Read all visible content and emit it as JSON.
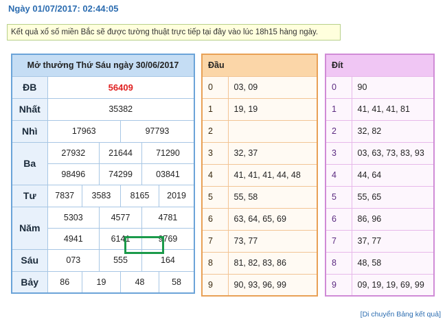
{
  "date_line": "Ngày 01/07/2017: 02:44:05",
  "notice": "Kết quả xổ số miền Bắc sẽ được tường thuật trực tiếp tại đây vào lúc 18h15 hàng ngày.",
  "results": {
    "header": "Mở thưởng Thứ Sáu ngày 30/06/2017",
    "rows": [
      {
        "label": "ĐB",
        "values": [
          [
            "56409"
          ]
        ]
      },
      {
        "label": "Nhất",
        "values": [
          [
            "35382"
          ]
        ]
      },
      {
        "label": "Nhì",
        "values": [
          [
            "17963",
            "97793"
          ]
        ]
      },
      {
        "label": "Ba",
        "values": [
          [
            "27932",
            "21644",
            "71290"
          ],
          [
            "98496",
            "74299",
            "03841"
          ]
        ]
      },
      {
        "label": "Tư",
        "values": [
          [
            "7837",
            "3583",
            "8165",
            "2019"
          ]
        ]
      },
      {
        "label": "Năm",
        "values": [
          [
            "5303",
            "4577",
            "4781"
          ],
          [
            "4941",
            "6141",
            "9769"
          ]
        ]
      },
      {
        "label": "Sáu",
        "values": [
          [
            "073",
            "555",
            "164"
          ]
        ]
      },
      {
        "label": "Bảy",
        "values": [
          [
            "86",
            "19",
            "48",
            "58"
          ]
        ]
      }
    ]
  },
  "dau": {
    "header": "Đầu",
    "rows": [
      {
        "k": "0",
        "v": "03, 09"
      },
      {
        "k": "1",
        "v": "19, 19"
      },
      {
        "k": "2",
        "v": ""
      },
      {
        "k": "3",
        "v": "32, 37"
      },
      {
        "k": "4",
        "v": "41, 41, 41, 44, 48"
      },
      {
        "k": "5",
        "v": "55, 58"
      },
      {
        "k": "6",
        "v": "63, 64, 65, 69"
      },
      {
        "k": "7",
        "v": "73, 77"
      },
      {
        "k": "8",
        "v": "81, 82, 83, 86"
      },
      {
        "k": "9",
        "v": "90, 93, 96, 99"
      }
    ]
  },
  "dit": {
    "header": "Đít",
    "rows": [
      {
        "k": "0",
        "v": "90"
      },
      {
        "k": "1",
        "v": "41, 41, 41, 81"
      },
      {
        "k": "2",
        "v": "32, 82"
      },
      {
        "k": "3",
        "v": "03, 63, 73, 83, 93"
      },
      {
        "k": "4",
        "v": "44, 64"
      },
      {
        "k": "5",
        "v": "55, 65"
      },
      {
        "k": "6",
        "v": "86, 96"
      },
      {
        "k": "7",
        "v": "37, 77"
      },
      {
        "k": "8",
        "v": "48, 58"
      },
      {
        "k": "9",
        "v": "09, 19, 19, 69, 99"
      }
    ]
  },
  "move_link": "[Di chuyển Bảng kết quả]",
  "colors": {
    "title_blue": "#2b6cb0",
    "special_red": "#e02020",
    "highlight_green": "#1a9a4a"
  }
}
